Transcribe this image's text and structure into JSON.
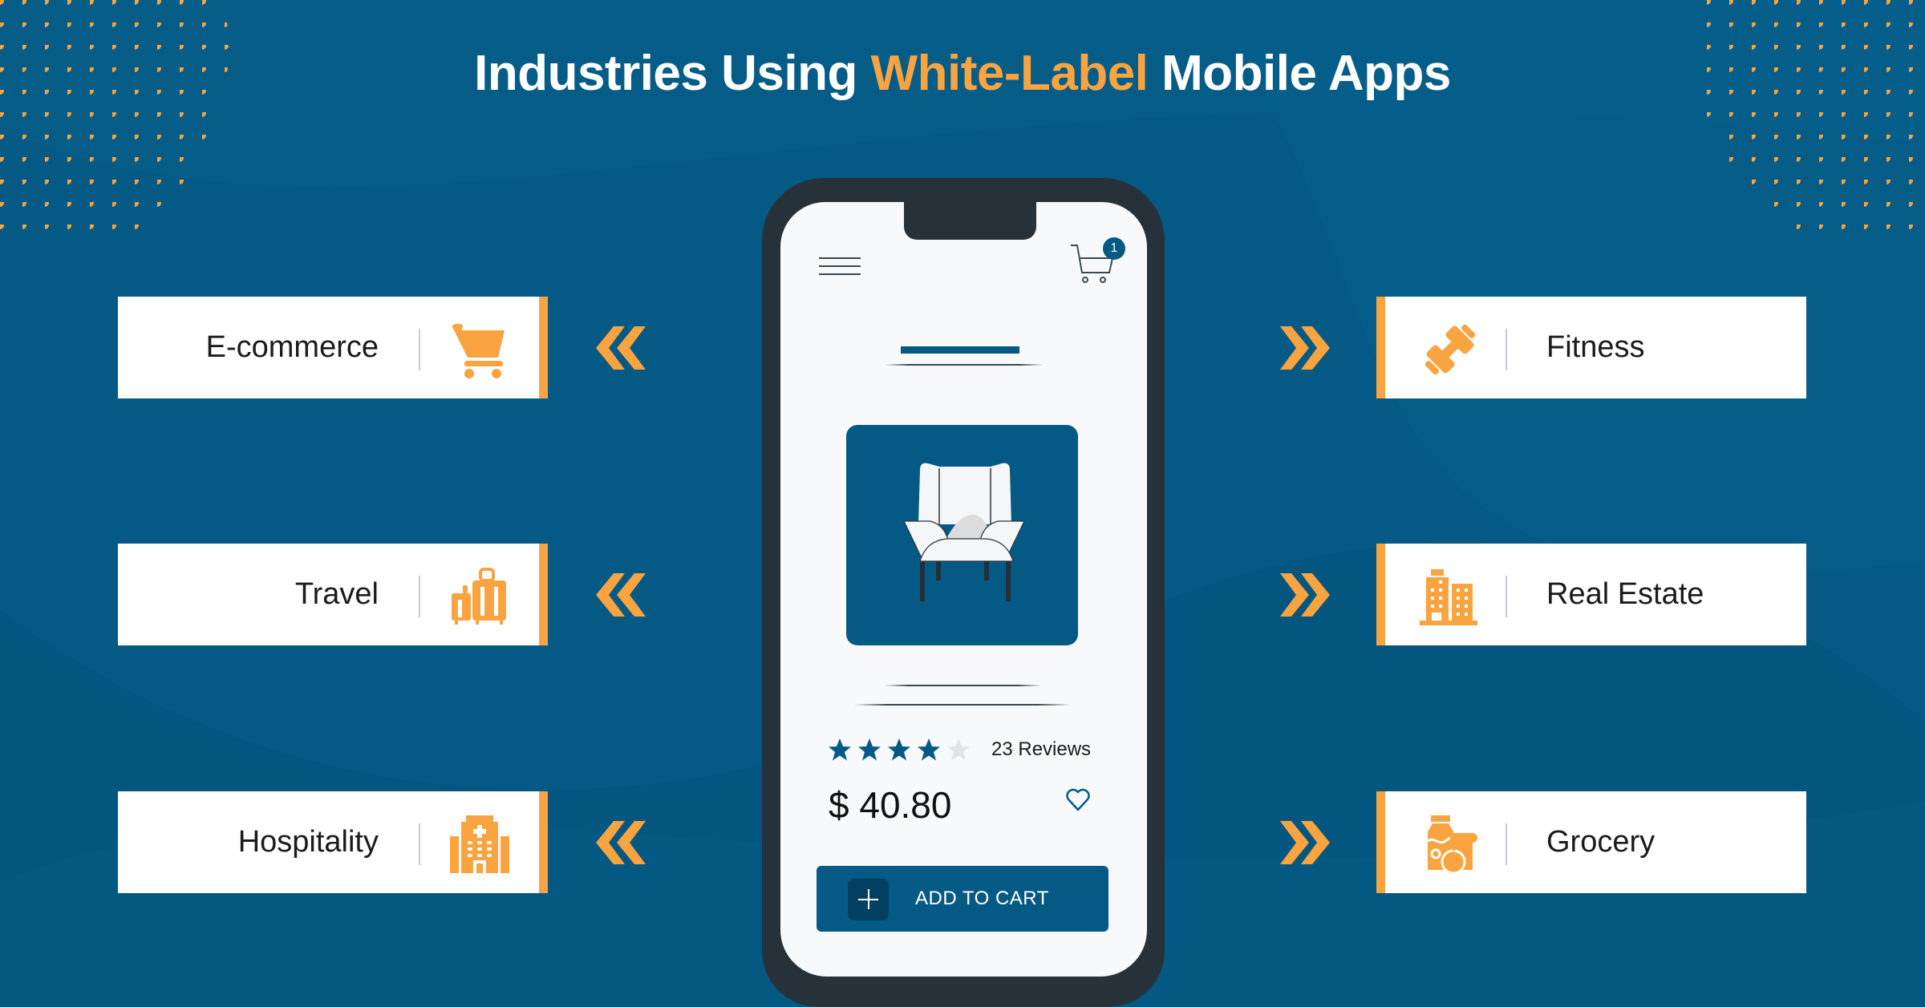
{
  "title": {
    "prefix": "Industries Using ",
    "highlight": "White-Label",
    "suffix": " Mobile Apps"
  },
  "colors": {
    "background": "#045a84",
    "accent": "#f9a440",
    "phone_frame": "#263139",
    "card": "#ffffff",
    "text_dark": "#1b1b1b"
  },
  "industries_left": [
    {
      "label": "E-commerce",
      "icon": "shopping-cart-icon"
    },
    {
      "label": "Travel",
      "icon": "luggage-icon"
    },
    {
      "label": "Hospitality",
      "icon": "hospital-building-icon"
    }
  ],
  "industries_right": [
    {
      "label": "Fitness",
      "icon": "dumbbell-icon"
    },
    {
      "label": "Real Estate",
      "icon": "buildings-icon"
    },
    {
      "label": "Grocery",
      "icon": "groceries-icon"
    }
  ],
  "phone": {
    "menu_icon": "hamburger-menu-icon",
    "cart_icon": "cart-icon",
    "cart_badge": "1",
    "product_image": "armchair-icon",
    "rating": 4,
    "rating_max": 5,
    "reviews": "23 Reviews",
    "price": "$ 40.80",
    "favorite_icon": "heart-icon",
    "add_to_cart": "ADD TO CART"
  }
}
